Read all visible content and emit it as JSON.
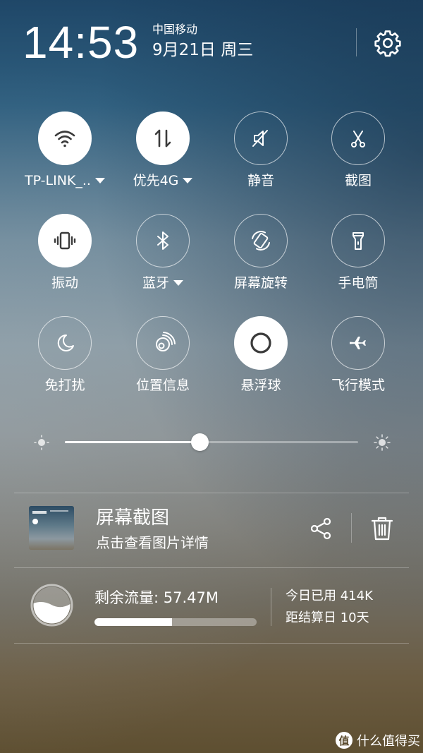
{
  "header": {
    "time": "14:53",
    "carrier": "中国移动",
    "date": "9月21日 周三",
    "settings_icon": "gear-icon"
  },
  "toggles": [
    {
      "label": "TP-LINK_..",
      "icon": "wifi-icon",
      "active": true,
      "dropdown": true
    },
    {
      "label": "优先4G",
      "icon": "mobile-data-icon",
      "active": true,
      "dropdown": true
    },
    {
      "label": "静音",
      "icon": "mute-icon",
      "active": false,
      "dropdown": false
    },
    {
      "label": "截图",
      "icon": "scissors-icon",
      "active": false,
      "dropdown": false
    },
    {
      "label": "振动",
      "icon": "vibrate-icon",
      "active": true,
      "dropdown": false
    },
    {
      "label": "蓝牙",
      "icon": "bluetooth-icon",
      "active": false,
      "dropdown": true
    },
    {
      "label": "屏幕旋转",
      "icon": "rotate-icon",
      "active": false,
      "dropdown": false
    },
    {
      "label": "手电筒",
      "icon": "flashlight-icon",
      "active": false,
      "dropdown": false
    },
    {
      "label": "免打扰",
      "icon": "moon-icon",
      "active": false,
      "dropdown": false
    },
    {
      "label": "位置信息",
      "icon": "location-icon",
      "active": false,
      "dropdown": false
    },
    {
      "label": "悬浮球",
      "icon": "floating-ball-icon",
      "active": true,
      "dropdown": false
    },
    {
      "label": "飞行模式",
      "icon": "airplane-icon",
      "active": false,
      "dropdown": false
    }
  ],
  "brightness": {
    "level": 0.46
  },
  "notification": {
    "title": "屏幕截图",
    "subtitle": "点击查看图片详情",
    "share_icon": "share-icon",
    "delete_icon": "trash-icon"
  },
  "data_usage": {
    "remaining_label": "剩余流量: 57.47M",
    "used_fraction": 0.48,
    "today_used": "今日已用 414K",
    "days_left": "距结算日 10天"
  },
  "watermark": {
    "badge": "值",
    "text": "什么值得买"
  }
}
